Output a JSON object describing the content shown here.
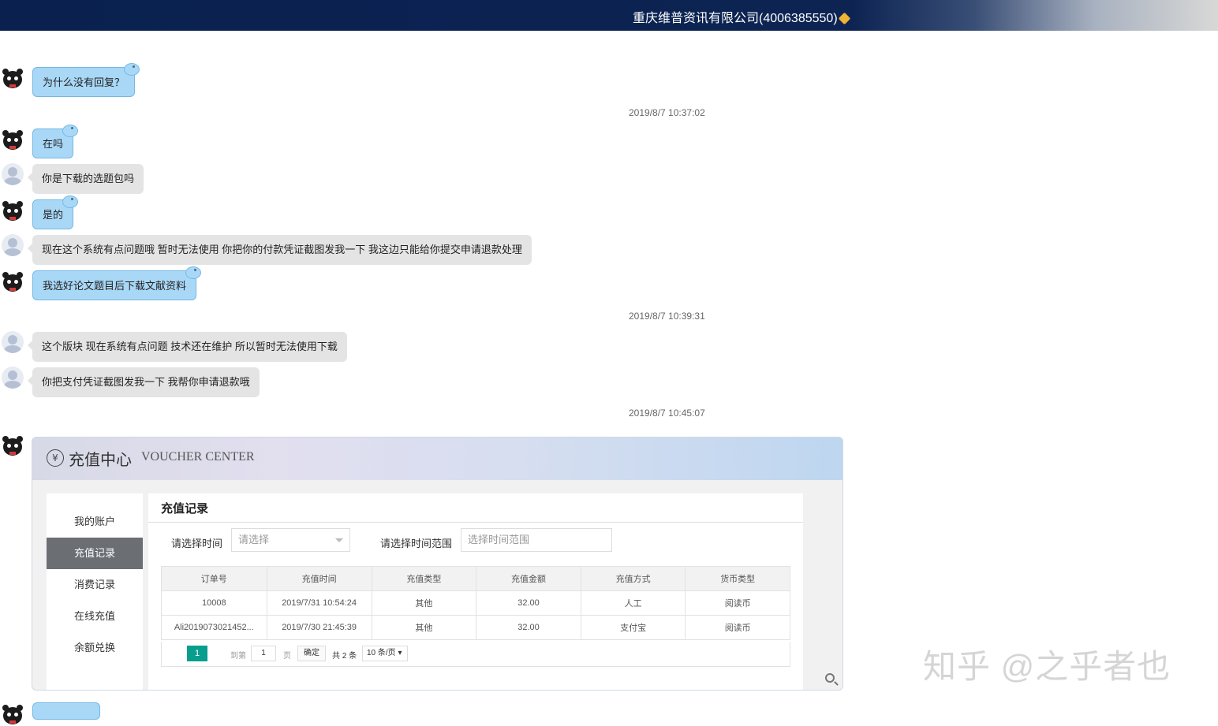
{
  "header": {
    "title": "重庆维普资讯有限公司(4006385550)"
  },
  "messages": [
    {
      "role": "agent",
      "text": "为什么没有回复？"
    },
    {
      "role": "time",
      "text": "2019/8/7 10:37:02"
    },
    {
      "role": "agent",
      "text": "在吗"
    },
    {
      "role": "user",
      "text": "你是下载的选题包吗"
    },
    {
      "role": "agent",
      "text": "是的"
    },
    {
      "role": "user",
      "text": "现在这个系统有点问题哦 暂时无法使用 你把你的付款凭证截图发我一下 我这边只能给你提交申请退款处理"
    },
    {
      "role": "agent",
      "text": "我选好论文题目后下载文献资料"
    },
    {
      "role": "time",
      "text": "2019/8/7 10:39:31"
    },
    {
      "role": "user",
      "text": "这个版块 现在系统有点问题 技术还在维护 所以暂时无法使用下载"
    },
    {
      "role": "user",
      "text": "你把支付凭证截图发我一下 我帮你申请退款哦"
    },
    {
      "role": "time",
      "text": "2019/8/7 10:45:07"
    }
  ],
  "screenshot": {
    "yen_symbol": "¥",
    "title_zh": "充值中心",
    "title_en": "VOUCHER CENTER",
    "sidebar": [
      "我的账户",
      "充值记录",
      "消费记录",
      "在线充值",
      "余额兑换"
    ],
    "section_title": "充值记录",
    "filter_time_label": "请选择时间",
    "filter_time_placeholder": "请选择",
    "filter_range_label": "请选择时间范围",
    "filter_range_placeholder": "选择时间范围",
    "columns": [
      "订单号",
      "充值时间",
      "充值类型",
      "充值金额",
      "充值方式",
      "货币类型"
    ],
    "rows": [
      [
        "10008",
        "2019/7/31 10:54:24",
        "其他",
        "32.00",
        "人工",
        "阅读币"
      ],
      [
        "Ali2019073021452...",
        "2019/7/30 21:45:39",
        "其他",
        "32.00",
        "支付宝",
        "阅读币"
      ]
    ],
    "pager": {
      "current": "1",
      "goto_label": "到第",
      "goto_value": "1",
      "page_unit": "页",
      "confirm": "确定",
      "total": "共 2 条",
      "per_page": "10 条/页 ▾"
    }
  },
  "watermark": "知乎 @之乎者也",
  "colors": {
    "topbar": "#0d2453",
    "agent_bubble": "#a9d8f7",
    "user_bubble": "#e4e4e4",
    "pager_active": "#089e8e"
  }
}
